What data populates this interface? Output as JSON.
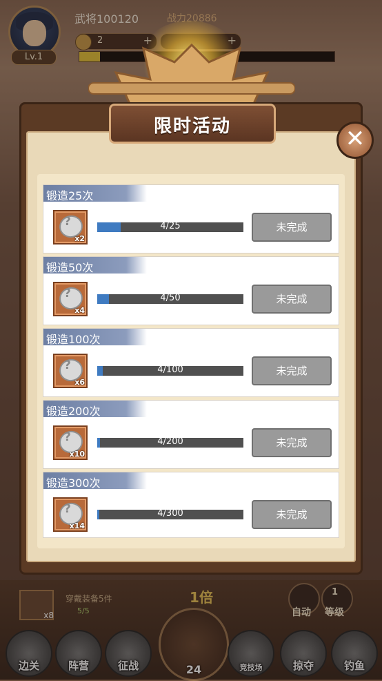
{
  "player": {
    "name": "武将100120",
    "power": "战力20886",
    "level": "Lv.1",
    "coins": "2",
    "xp_fraction": 0.08
  },
  "modal": {
    "title": "限时活动",
    "close": "✕"
  },
  "tasks": [
    {
      "label": "锻造25次",
      "reward_count": "x2",
      "progress_text": "4/25",
      "progress": 0.16,
      "status": "未完成"
    },
    {
      "label": "锻造50次",
      "reward_count": "x4",
      "progress_text": "4/50",
      "progress": 0.08,
      "status": "未完成"
    },
    {
      "label": "锻造100次",
      "reward_count": "x6",
      "progress_text": "4/100",
      "progress": 0.04,
      "status": "未完成"
    },
    {
      "label": "锻造200次",
      "reward_count": "x10",
      "progress_text": "4/200",
      "progress": 0.02,
      "status": "未完成"
    },
    {
      "label": "锻造300次",
      "reward_count": "x14",
      "progress_text": "4/300",
      "progress": 0.013,
      "status": "未完成"
    }
  ],
  "bottom": {
    "equip_count": "x8",
    "equip_text": "穿戴装备5件",
    "equip_sub": "5/5",
    "multiplier": "1倍",
    "auto_label": "自动",
    "level_label": "等级",
    "level_num": "1",
    "hammer_count": "24",
    "nav": [
      "边关",
      "阵营",
      "征战",
      "竞技场",
      "掠夺",
      "钓鱼"
    ]
  },
  "colors": {
    "progress_fill": "#3f7bc1",
    "tab_blue": "#6d7fa3",
    "button_gray": "#9a9a9a"
  }
}
